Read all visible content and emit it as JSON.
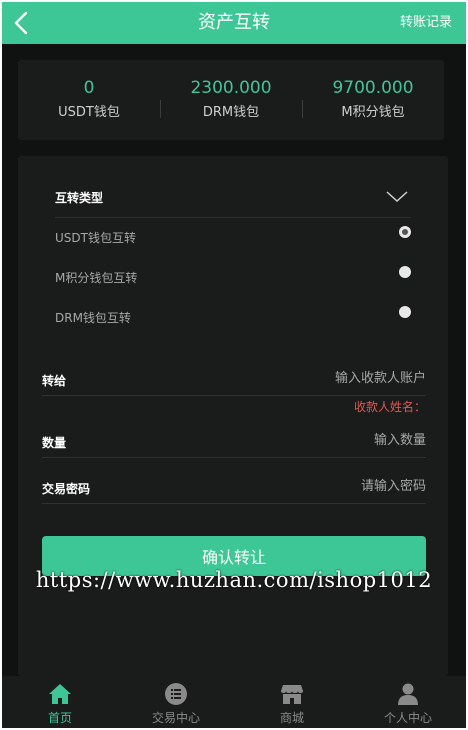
{
  "header": {
    "title": "资产互转",
    "right_link": "转账记录"
  },
  "balances": [
    {
      "value": "0",
      "label": "USDT钱包"
    },
    {
      "value": "2300.000",
      "label": "DRM钱包"
    },
    {
      "value": "9700.000",
      "label": "M积分钱包"
    }
  ],
  "transfer": {
    "type_label": "互转类型",
    "options": [
      {
        "label": "USDT钱包互转",
        "checked": true
      },
      {
        "label": "M积分钱包互转",
        "checked": false
      },
      {
        "label": "DRM钱包互转",
        "checked": false
      }
    ],
    "fields": {
      "to_label": "转给",
      "to_placeholder": "输入收款人账户",
      "recipient_name": "收款人姓名：",
      "amount_label": "数量",
      "amount_placeholder": "输入数量",
      "password_label": "交易密码",
      "password_placeholder": "请输入密码"
    },
    "confirm_label": "确认转让"
  },
  "watermark": "https://www.huzhan.com/ishop1012",
  "tabbar": [
    {
      "label": "首页",
      "active": true
    },
    {
      "label": "交易中心",
      "active": false
    },
    {
      "label": "商城",
      "active": false
    },
    {
      "label": "个人中心",
      "active": false
    }
  ],
  "colors": {
    "accent": "#3ec796",
    "background": "#101212",
    "card": "#1a1c1c",
    "warning": "#e0574f"
  }
}
